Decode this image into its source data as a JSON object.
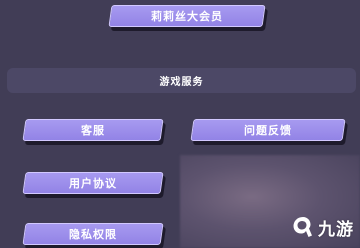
{
  "membership": {
    "label": "莉莉丝大会员"
  },
  "game_services": {
    "title": "游戏服务",
    "buttons": {
      "customer_service": "客服",
      "feedback": "问题反馈",
      "user_agreement": "用户协议",
      "privacy": "隐私权限"
    }
  },
  "watermark": {
    "text": "九游",
    "icon": "jiuyou-logo-icon"
  },
  "colors": {
    "background": "#413d56",
    "section_bar": "#4c4866",
    "button_fill": "#9a8bec",
    "button_border": "#d2c9ff",
    "button_shadow": "#1e1b2c"
  }
}
